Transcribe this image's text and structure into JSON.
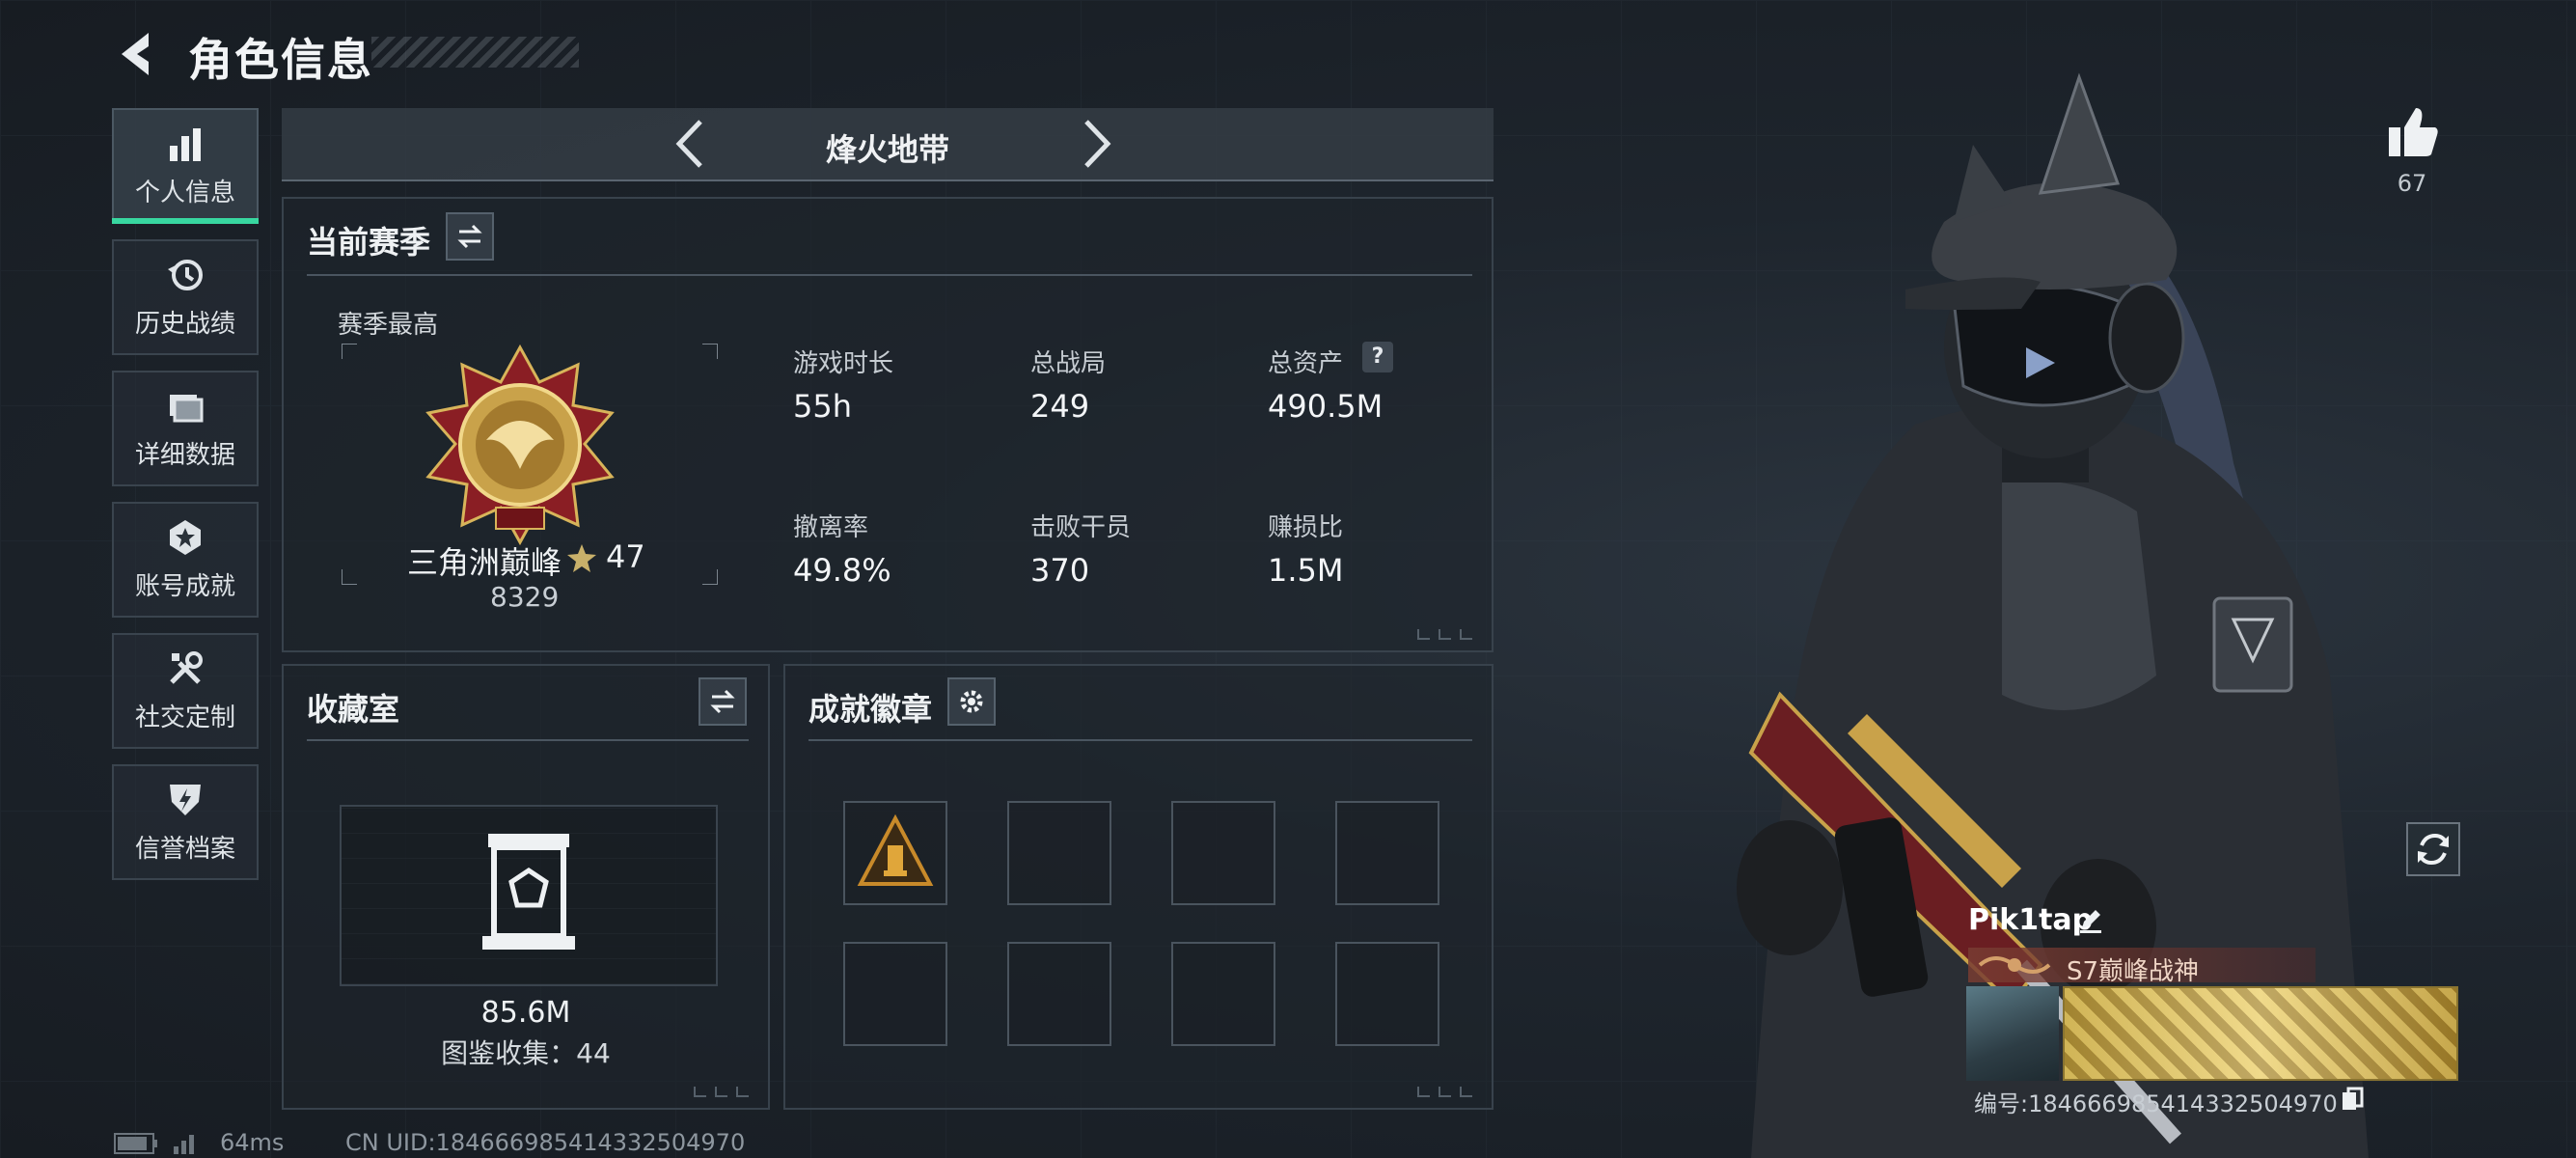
{
  "header": {
    "title": "角色信息"
  },
  "sidebar": {
    "items": [
      {
        "label": "个人信息",
        "icon": "bar-chart-icon",
        "active": true
      },
      {
        "label": "历史战绩",
        "icon": "history-icon"
      },
      {
        "label": "详细数据",
        "icon": "folder-icon"
      },
      {
        "label": "账号成就",
        "icon": "achievement-icon"
      },
      {
        "label": "社交定制",
        "icon": "tools-icon"
      },
      {
        "label": "信誉档案",
        "icon": "credit-icon"
      }
    ]
  },
  "map": {
    "name": "烽火地带"
  },
  "season": {
    "title": "当前赛季",
    "best_label": "赛季最高",
    "rank_name": "三角洲巅峰",
    "rank_stars": "47",
    "rank_points": "8329",
    "stats": [
      {
        "label": "游戏时长",
        "value": "55h"
      },
      {
        "label": "总战局",
        "value": "249"
      },
      {
        "label": "总资产",
        "value": "490.5M"
      },
      {
        "label": "撤离率",
        "value": "49.8%"
      },
      {
        "label": "击败干员",
        "value": "370"
      },
      {
        "label": "赚损比",
        "value": "1.5M"
      }
    ]
  },
  "collection": {
    "title": "收藏室",
    "value": "85.6M",
    "count_text": "图鉴收集：44"
  },
  "badges": {
    "title": "成就徽章",
    "slots": 8,
    "filled_slots": 1
  },
  "profile": {
    "likes": "67",
    "player_name": "Pik1tap",
    "title": "S7巅峰战神",
    "id_text": "编号:184666985414332504970"
  },
  "footer": {
    "ping": "64ms",
    "uid": "CN UID:184666985414332504970"
  },
  "colors": {
    "accent_green": "#38d7a0",
    "panel_border": "#38424c",
    "background": "#1b2128"
  }
}
